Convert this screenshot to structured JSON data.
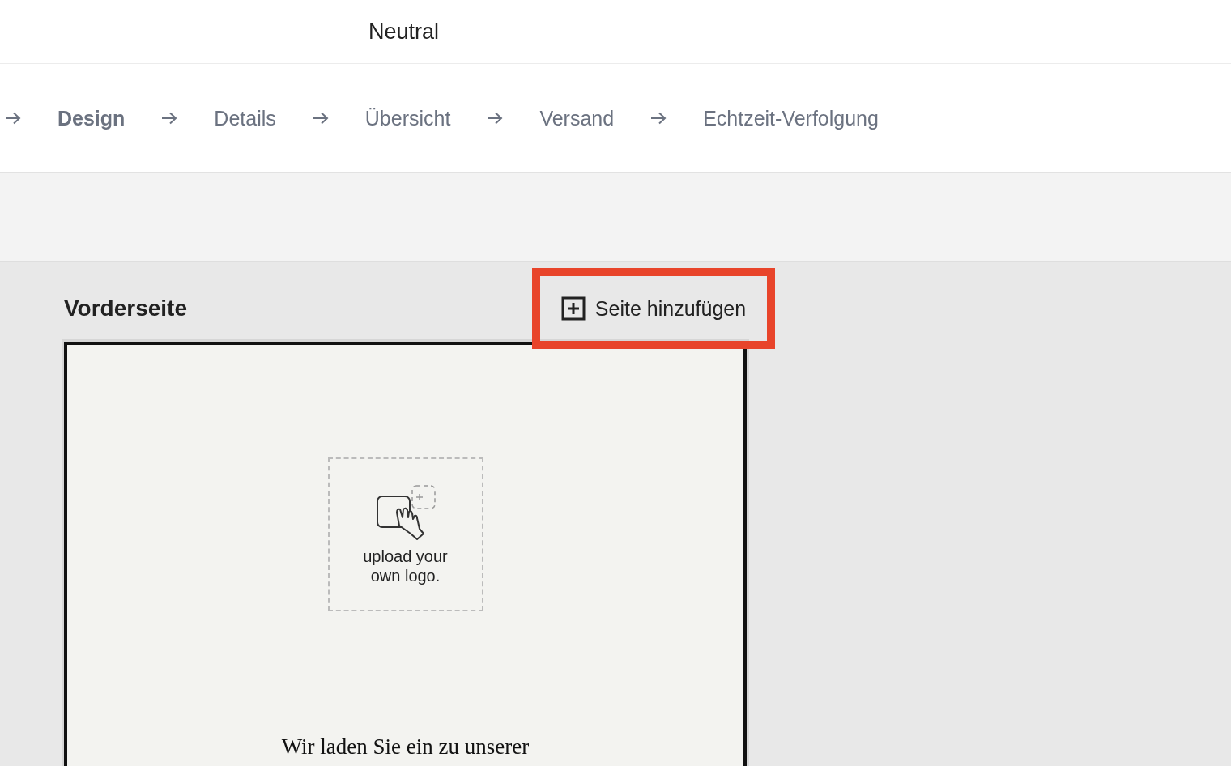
{
  "header": {
    "title": "Neutral"
  },
  "steps": [
    {
      "label": "Design",
      "selected": true
    },
    {
      "label": "Details",
      "selected": false
    },
    {
      "label": "Übersicht",
      "selected": false
    },
    {
      "label": "Versand",
      "selected": false
    },
    {
      "label": "Echtzeit-Verfolgung",
      "selected": false
    }
  ],
  "page": {
    "title": "Vorderseite",
    "add_button": {
      "label": "Seite hinzufügen",
      "highlighted": true
    }
  },
  "card": {
    "upload_label": "upload your own logo.",
    "invitation_text": "Wir laden Sie ein zu unserer"
  }
}
